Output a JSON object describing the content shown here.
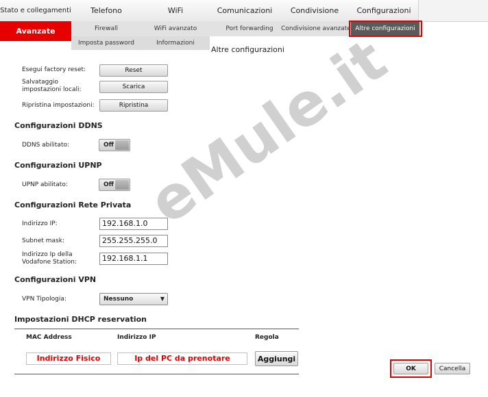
{
  "nav": {
    "tabs": [
      {
        "label": "Stato e collegamenti"
      },
      {
        "label": "Telefono"
      },
      {
        "label": "WiFi"
      },
      {
        "label": "Comunicazioni"
      },
      {
        "label": "Condivisione"
      },
      {
        "label": "Configurazioni"
      }
    ],
    "side_active": "Avanzate"
  },
  "subnav": {
    "row1": [
      "Firewall",
      "WiFi avanzato",
      "Port forwarding",
      "Condivisione avanzate",
      "Altre configurazioni"
    ],
    "row2": [
      "Imposta password",
      "Informazioni"
    ]
  },
  "page_title": "Altre configurazioni",
  "general": {
    "reset_label": "Esegui factory reset:",
    "reset_btn": "Reset",
    "save_label": "Salvataggio impostazioni locali:",
    "save_btn": "Scarica",
    "restore_label": "Ripristina impostazioni:",
    "restore_btn": "Ripristina"
  },
  "ddns": {
    "title": "Configurazioni DDNS",
    "label": "DDNS abilitato:",
    "state": "Off"
  },
  "upnp": {
    "title": "Configurazioni UPNP",
    "label": "UPNP abilitato:",
    "state": "Off"
  },
  "lan": {
    "title": "Configurazioni Rete Privata",
    "ip_label": "Indirizzo IP:",
    "ip_value": "192.168.1.0",
    "mask_label": "Subnet mask:",
    "mask_value": "255.255.255.0",
    "station_label": "Indirizzo Ip della Vodafone Station:",
    "station_value": "192.168.1.1"
  },
  "vpn": {
    "title": "Configurazioni VPN",
    "label": "VPN Tipologia:",
    "value": "Nessuno"
  },
  "dhcp": {
    "title": "Impostazioni DHCP reservation",
    "col_mac": "MAC Address",
    "col_ip": "Indirizzo IP",
    "col_rule": "Regola",
    "mac_value": "Indirizzo Fisico",
    "ip_value": "Ip del PC da prenotare",
    "add_btn": "Aggiungi"
  },
  "actions": {
    "ok": "OK",
    "cancel": "Cancella"
  },
  "watermark": "eMule.it",
  "colors": {
    "accent_red": "#e60000",
    "highlight_box": "#e00000"
  }
}
